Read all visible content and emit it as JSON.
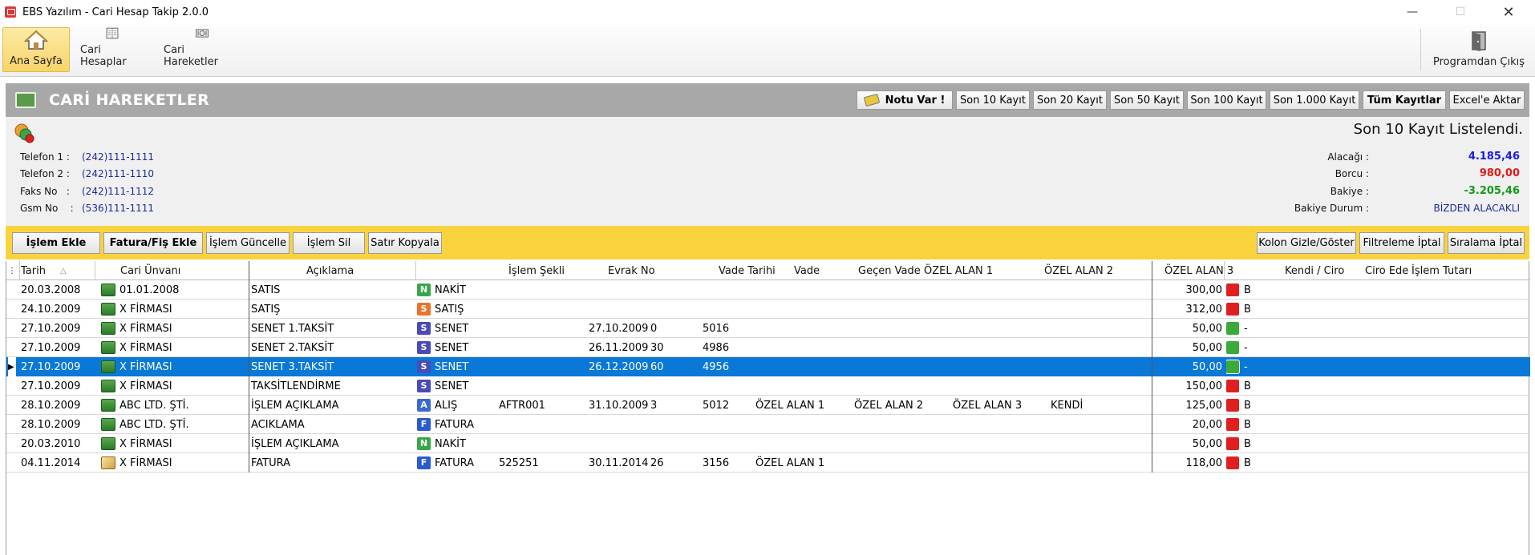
{
  "window": {
    "title": "EBS Yazılım - Cari Hesap Takip 2.0.0"
  },
  "menu": {
    "items": [
      {
        "label": "Ana Sayfa",
        "icon": "home-icon"
      },
      {
        "label": "Cari Hesaplar",
        "icon": "ledger-icon"
      },
      {
        "label": "Cari Hareketler",
        "icon": "money-icon"
      }
    ],
    "exit_label": "Programdan Çıkış"
  },
  "header": {
    "title": "CARİ HAREKETLER",
    "buttons": {
      "note": "Notu Var !",
      "last10": "Son 10 Kayıt",
      "last20": "Son 20 Kayıt",
      "last50": "Son 50 Kayıt",
      "last100": "Son 100 Kayıt",
      "last1000": "Son 1.000 Kayıt",
      "all": "Tüm Kayıtlar",
      "excel": "Excel'e Aktar"
    }
  },
  "info": {
    "list_message": "Son 10 Kayıt Listelendi.",
    "phone1_label": "Telefon 1 :",
    "phone1": "(242)111-1111",
    "phone2_label": "Telefon 2 :",
    "phone2": "(242)111-1110",
    "fax_label": "Faks No   :",
    "fax": "(242)111-1112",
    "gsm_label": "Gsm No    :",
    "gsm": "(536)111-1111",
    "receivable_label": "Alacağı :",
    "receivable": "4.185,46",
    "debt_label": "Borcu :",
    "debt": "980,00",
    "balance_label": "Bakiye :",
    "balance": "-3.205,46",
    "balance_status_label": "Bakiye Durum :",
    "balance_status": "BİZDEN ALACAKLI",
    "colors": {
      "receivable": "#1a1ae0",
      "debt": "#e01a1a",
      "balance": "#159a15",
      "status": "#1a2a9c"
    }
  },
  "actions": {
    "add": "İşlem Ekle",
    "invoice_add": "Fatura/Fiş Ekle",
    "update": "İşlem Güncelle",
    "delete": "İşlem Sil",
    "copy_row": "Satır Kopyala",
    "toggle_columns": "Kolon Gizle/Göster",
    "cancel_filter": "Filtreleme İptal",
    "cancel_sort": "Sıralama İptal"
  },
  "grid": {
    "columns": [
      "Tarih",
      "Cari Ünvanı",
      "Açıklama",
      "İşlem Şekli",
      "Evrak No",
      "Vade Tarihi",
      "Vade",
      "Geçen Vade",
      "ÖZEL ALAN 1",
      "ÖZEL ALAN 2",
      "ÖZEL ALAN 3",
      "Kendi / Ciro",
      "Ciro Ede",
      "İşlem Tutarı"
    ],
    "selected_row": 4,
    "rows": [
      {
        "date": "20.03.2008",
        "party": "01.01.2008",
        "desc": "SATIS",
        "type_letter": "N",
        "type": "NAKİT",
        "doc": "",
        "due_date": "",
        "due": "",
        "elapsed": "",
        "f1": "",
        "f2": "",
        "f3": "",
        "own": "",
        "endorsed": "",
        "amount": "300,00",
        "status": "red",
        "flag": "B",
        "party_icon": "money"
      },
      {
        "date": "24.10.2009",
        "party": "X FİRMASI",
        "desc": "SATIŞ",
        "type_letter": "S",
        "type": "SATIŞ",
        "doc": "",
        "due_date": "",
        "due": "",
        "elapsed": "",
        "f1": "",
        "f2": "",
        "f3": "",
        "own": "",
        "endorsed": "",
        "amount": "312,00",
        "status": "red",
        "flag": "B",
        "party_icon": "money"
      },
      {
        "date": "27.10.2009",
        "party": "X FİRMASI",
        "desc": "SENET 1.TAKSİT",
        "type_letter": "S",
        "type": "SENET",
        "doc": "",
        "due_date": "27.10.2009",
        "due": "0",
        "elapsed": "5016",
        "f1": "",
        "f2": "",
        "f3": "",
        "own": "",
        "endorsed": "",
        "amount": "50,00",
        "status": "green",
        "flag": "-",
        "party_icon": "money"
      },
      {
        "date": "27.10.2009",
        "party": "X FİRMASI",
        "desc": "SENET 2.TAKSİT",
        "type_letter": "S",
        "type": "SENET",
        "doc": "",
        "due_date": "26.11.2009",
        "due": "30",
        "elapsed": "4986",
        "f1": "",
        "f2": "",
        "f3": "",
        "own": "",
        "endorsed": "",
        "amount": "50,00",
        "status": "green",
        "flag": "-",
        "party_icon": "money"
      },
      {
        "date": "27.10.2009",
        "party": "X FİRMASI",
        "desc": "SENET 3.TAKSİT",
        "type_letter": "S",
        "type": "SENET",
        "doc": "",
        "due_date": "26.12.2009",
        "due": "60",
        "elapsed": "4956",
        "f1": "",
        "f2": "",
        "f3": "",
        "own": "",
        "endorsed": "",
        "amount": "50,00",
        "status": "green",
        "flag": "-",
        "party_icon": "money"
      },
      {
        "date": "27.10.2009",
        "party": "X FİRMASI",
        "desc": "TAKSİTLENDİRME",
        "type_letter": "S",
        "type": "SENET",
        "doc": "",
        "due_date": "",
        "due": "",
        "elapsed": "",
        "f1": "",
        "f2": "",
        "f3": "",
        "own": "",
        "endorsed": "",
        "amount": "150,00",
        "status": "red",
        "flag": "B",
        "party_icon": "money"
      },
      {
        "date": "28.10.2009",
        "party": "ABC LTD. ŞTİ.",
        "desc": "İŞLEM AÇIKLAMA",
        "type_letter": "A",
        "type": "ALIŞ",
        "doc": "AFTR001",
        "due_date": "31.10.2009",
        "due": "3",
        "elapsed": "5012",
        "f1": "ÖZEL ALAN 1",
        "f2": "ÖZEL ALAN 2",
        "f3": "ÖZEL ALAN 3",
        "own": "KENDİ",
        "endorsed": "",
        "amount": "125,00",
        "status": "red",
        "flag": "B",
        "party_icon": "money"
      },
      {
        "date": "28.10.2009",
        "party": "ABC LTD. ŞTİ.",
        "desc": "ACIKLAMA",
        "type_letter": "F",
        "type": "FATURA",
        "doc": "",
        "due_date": "",
        "due": "",
        "elapsed": "",
        "f1": "",
        "f2": "",
        "f3": "",
        "own": "",
        "endorsed": "",
        "amount": "20,00",
        "status": "red",
        "flag": "B",
        "party_icon": "money"
      },
      {
        "date": "20.03.2010",
        "party": "X FİRMASI",
        "desc": "İŞLEM AÇIKLAMA",
        "type_letter": "N",
        "type": "NAKİT",
        "doc": "",
        "due_date": "",
        "due": "",
        "elapsed": "",
        "f1": "",
        "f2": "",
        "f3": "",
        "own": "",
        "endorsed": "",
        "amount": "50,00",
        "status": "red",
        "flag": "B",
        "party_icon": "money"
      },
      {
        "date": "04.11.2014",
        "party": "X FİRMASI",
        "desc": "FATURA",
        "type_letter": "F",
        "type": "FATURA",
        "doc": "525251",
        "due_date": "30.11.2014",
        "due": "26",
        "elapsed": "3156",
        "f1": "ÖZEL ALAN 1",
        "f2": "",
        "f3": "",
        "own": "",
        "endorsed": "",
        "amount": "118,00",
        "status": "red",
        "flag": "B",
        "party_icon": "invoice"
      }
    ],
    "type_colors": {
      "N": "#3aa64a",
      "S": "#4a4ab8",
      "A": "#3a6ad0",
      "F": "#2a5ad0"
    },
    "type_colors_alt": {
      "SATIŞ": "#e8742a"
    },
    "status_colors": {
      "red": "#e02020",
      "green": "#3aaa3a"
    }
  }
}
